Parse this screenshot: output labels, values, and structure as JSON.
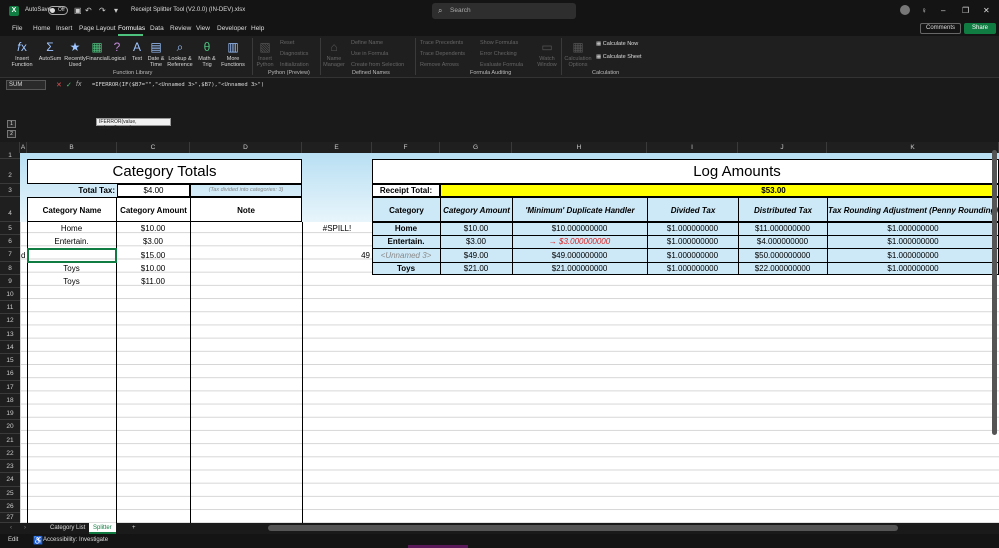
{
  "titlebar": {
    "autosave_label": "AutoSave",
    "autosave_state": "Off",
    "doc_title": "Receipt Splitter Tool (V2.0.0) (IN-DEV).xlsx",
    "search_placeholder": "Search"
  },
  "menu": [
    "File",
    "Home",
    "Insert",
    "Page Layout",
    "Formulas",
    "Data",
    "Review",
    "View",
    "Developer",
    "Help"
  ],
  "menu_active": "Formulas",
  "buttons": {
    "comments": "Comments",
    "share": "Share"
  },
  "ribbon": {
    "insert_function": "Insert Function",
    "autosum": "AutoSum",
    "recently_used": "Recently Used",
    "financial": "Financial",
    "logical": "Logical",
    "text": "Text",
    "date_time": "Date & Time",
    "lookup": "Lookup & Reference",
    "math": "Math & Trig",
    "more": "More Functions",
    "insert_python": "Insert Python",
    "reset": "Reset",
    "diagnostics": "Diagnostics",
    "initialization": "Initialization",
    "name_manager": "Name Manager",
    "define_name": "Define Name",
    "use_in_formula": "Use in Formula",
    "create_from_selection": "Create from Selection",
    "trace_precedents": "Trace Precedents",
    "trace_dependents": "Trace Dependents",
    "remove_arrows": "Remove Arrows",
    "show_formulas": "Show Formulas",
    "error_checking": "Error Checking",
    "evaluate_formula": "Evaluate Formula",
    "watch_window": "Watch Window",
    "calc_options": "Calculation Options",
    "calc_now": "Calculate Now",
    "calc_sheet": "Calculate Sheet",
    "groups": [
      "Function Library",
      "Python (Preview)",
      "Defined Names",
      "Formula Auditing",
      "Calculation"
    ]
  },
  "formula_bar": {
    "name_box": "SUM",
    "formula": "=IFERROR(IF($B7=\"\",\"<Unnamed 3>\",$B7),\"<Unnamed 3>\")",
    "tooltip": "IFERROR(value, value_if_error)"
  },
  "columns": [
    "A",
    "B",
    "C",
    "D",
    "E",
    "F",
    "G",
    "H",
    "I",
    "J",
    "K"
  ],
  "rows": [
    "1",
    "2",
    "3",
    "4",
    "5",
    "6",
    "7",
    "8",
    "9",
    "10",
    "11",
    "12",
    "13",
    "14",
    "15",
    "16",
    "17",
    "18",
    "19",
    "20",
    "21",
    "22",
    "23",
    "24",
    "25",
    "26",
    "27"
  ],
  "category_totals": {
    "title": "Category Totals",
    "total_tax_label": "Total Tax:",
    "total_tax_value": "$4.00",
    "tax_note": "(Tax divided into categories: 3)",
    "headers": [
      "Category Name",
      "Category Amount",
      "Note"
    ],
    "rows": [
      {
        "name": "Home",
        "amount": "$10.00"
      },
      {
        "name": "Entertain.",
        "amount": "$3.00"
      },
      {
        "name": "",
        "amount": "$15.00"
      },
      {
        "name": "Toys",
        "amount": "$10.00"
      },
      {
        "name": "Toys",
        "amount": "$11.00"
      }
    ],
    "editing_text": "d",
    "spill": "#SPILL!",
    "e7_value": "49"
  },
  "log_amounts": {
    "title": "Log Amounts",
    "receipt_total_label": "Receipt Total:",
    "receipt_total_value": "$53.00",
    "headers": [
      "Category",
      "Category Amount",
      "'Minimum' Duplicate Handler",
      "Divided Tax",
      "Distributed Tax",
      "Tax Rounding Adjustment (Penny Rounding)"
    ],
    "rows": [
      {
        "category": "Home",
        "amount": "$10.00",
        "dup": "$10.000000000",
        "divided": "$1.000000000",
        "distributed": "$11.000000000",
        "rounding": "$1.000000000"
      },
      {
        "category": "Entertain.",
        "amount": "$3.00",
        "dup": "→ $3.000000000",
        "divided": "$1.000000000",
        "distributed": "$4.000000000",
        "rounding": "$1.000000000"
      },
      {
        "category": "<Unnamed 3>",
        "amount": "$49.00",
        "dup": "$49.000000000",
        "divided": "$1.000000000",
        "distributed": "$50.000000000",
        "rounding": "$1.000000000"
      },
      {
        "category": "Toys",
        "amount": "$21.00",
        "dup": "$21.000000000",
        "divided": "$1.000000000",
        "distributed": "$22.000000000",
        "rounding": "$1.000000000"
      }
    ]
  },
  "sheet_tabs": [
    "Category List",
    "Splitter"
  ],
  "sheet_tab_active": "Splitter",
  "status": {
    "mode": "Edit",
    "accessibility": "Accessibility: Investigate"
  },
  "colors": {
    "excel_green": "#107c41",
    "header_blue": "#cde8f6",
    "total_yellow": "#ffff00",
    "dup_red": "#e02020"
  }
}
